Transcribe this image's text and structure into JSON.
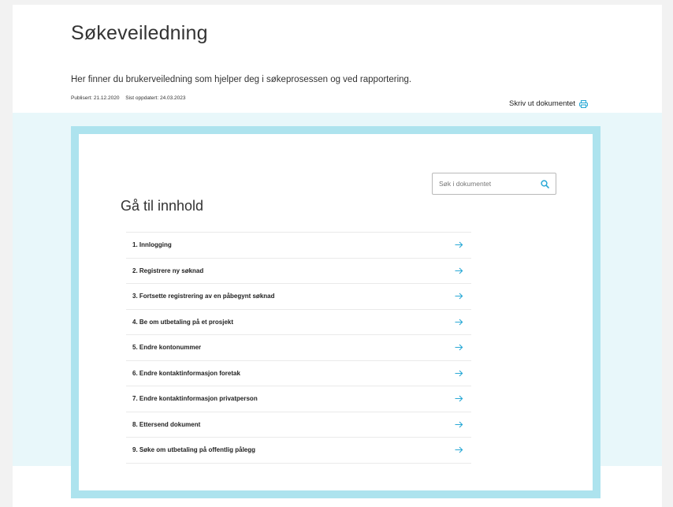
{
  "header": {
    "title": "Søkeveiledning",
    "intro": "Her finner du brukerveiledning som hjelper deg i søkeprosessen og ved rapportering.",
    "published": "Publisert: 21.12.2020",
    "updated": "Sist oppdatert: 24.03.2023",
    "print_label": "Skriv ut dokumentet",
    "print_icon": "printer-icon"
  },
  "search": {
    "placeholder": "Søk i dokumentet",
    "icon": "search-icon"
  },
  "toc": {
    "heading": "Gå til innhold",
    "items": [
      {
        "label": "1. Innlogging"
      },
      {
        "label": "2. Registrere ny søknad"
      },
      {
        "label": "3. Fortsette registrering av en påbegynt søknad"
      },
      {
        "label": "4. Be om utbetaling på et prosjekt"
      },
      {
        "label": "5. Endre kontonummer"
      },
      {
        "label": "6. Endre kontaktinformasjon foretak"
      },
      {
        "label": "7. Endre kontaktinformasjon privatperson"
      },
      {
        "label": "8. Ettersend dokument"
      },
      {
        "label": "9. Søke om utbetaling på offentlig pålegg"
      }
    ]
  },
  "colors": {
    "accent": "#2aa9d6",
    "band": "#e8f7fa",
    "frame": "#ade3ee"
  }
}
